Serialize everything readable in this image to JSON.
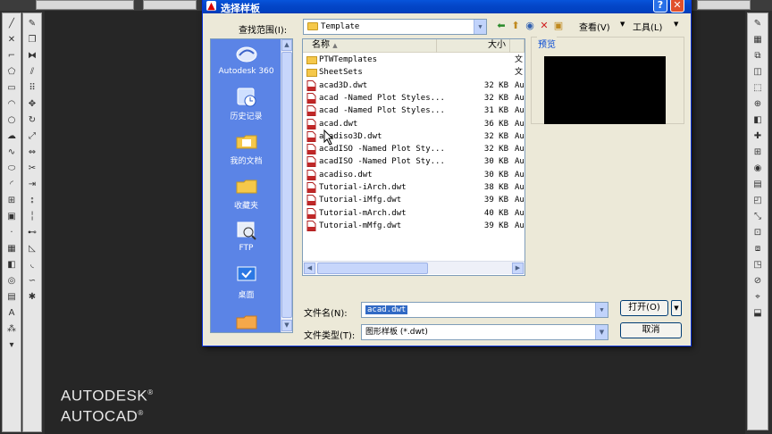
{
  "app": {
    "brand_line1": "AUTODESK",
    "brand_line2": "AUTOCAD",
    "brand_mark": "®"
  },
  "dialog": {
    "title": "选择样板",
    "help_glyph": "?",
    "close_glyph": "✕",
    "look_in_label": "查找范围(I):",
    "look_in_value": "Template",
    "view_label": "查看(V)",
    "tools_label": "工具(L)",
    "places": [
      {
        "label": "Autodesk 360",
        "icon": "cloud-icon"
      },
      {
        "label": "历史记录",
        "icon": "history-icon"
      },
      {
        "label": "我的文档",
        "icon": "documents-icon"
      },
      {
        "label": "收藏夹",
        "icon": "favorites-icon"
      },
      {
        "label": "FTP",
        "icon": "ftp-icon"
      },
      {
        "label": "桌面",
        "icon": "desktop-icon"
      }
    ],
    "columns": {
      "name": "名称",
      "size": "大小"
    },
    "files": [
      {
        "name": "PTWTemplates",
        "size": "",
        "type": "文",
        "kind": "folder"
      },
      {
        "name": "SheetSets",
        "size": "",
        "type": "文",
        "kind": "folder"
      },
      {
        "name": "acad3D.dwt",
        "size": "32 KB",
        "type": "Au",
        "kind": "file"
      },
      {
        "name": "acad -Named Plot Styles...",
        "size": "32 KB",
        "type": "Au",
        "kind": "file"
      },
      {
        "name": "acad -Named Plot Styles...",
        "size": "31 KB",
        "type": "Au",
        "kind": "file"
      },
      {
        "name": "acad.dwt",
        "size": "36 KB",
        "type": "Au",
        "kind": "file"
      },
      {
        "name": "acadiso3D.dwt",
        "size": "32 KB",
        "type": "Au",
        "kind": "file"
      },
      {
        "name": "acadISO -Named Plot Sty...",
        "size": "32 KB",
        "type": "Au",
        "kind": "file"
      },
      {
        "name": "acadISO -Named Plot Sty...",
        "size": "30 KB",
        "type": "Au",
        "kind": "file"
      },
      {
        "name": "acadiso.dwt",
        "size": "30 KB",
        "type": "Au",
        "kind": "file"
      },
      {
        "name": "Tutorial-iArch.dwt",
        "size": "38 KB",
        "type": "Au",
        "kind": "file"
      },
      {
        "name": "Tutorial-iMfg.dwt",
        "size": "39 KB",
        "type": "Au",
        "kind": "file"
      },
      {
        "name": "Tutorial-mArch.dwt",
        "size": "40 KB",
        "type": "Au",
        "kind": "file"
      },
      {
        "name": "Tutorial-mMfg.dwt",
        "size": "39 KB",
        "type": "Au",
        "kind": "file"
      }
    ],
    "preview_label": "预览",
    "filename_label": "文件名(N):",
    "filename_value": "acad.dwt",
    "filetype_label": "文件类型(T):",
    "filetype_value": "图形样板 (*.dwt)",
    "open_label": "打开(O)",
    "cancel_label": "取消"
  },
  "colors": {
    "titlebar": "#0446c8",
    "places_bar": "#5b84e6",
    "selection": "#316ac5",
    "canvas": "#262626"
  }
}
